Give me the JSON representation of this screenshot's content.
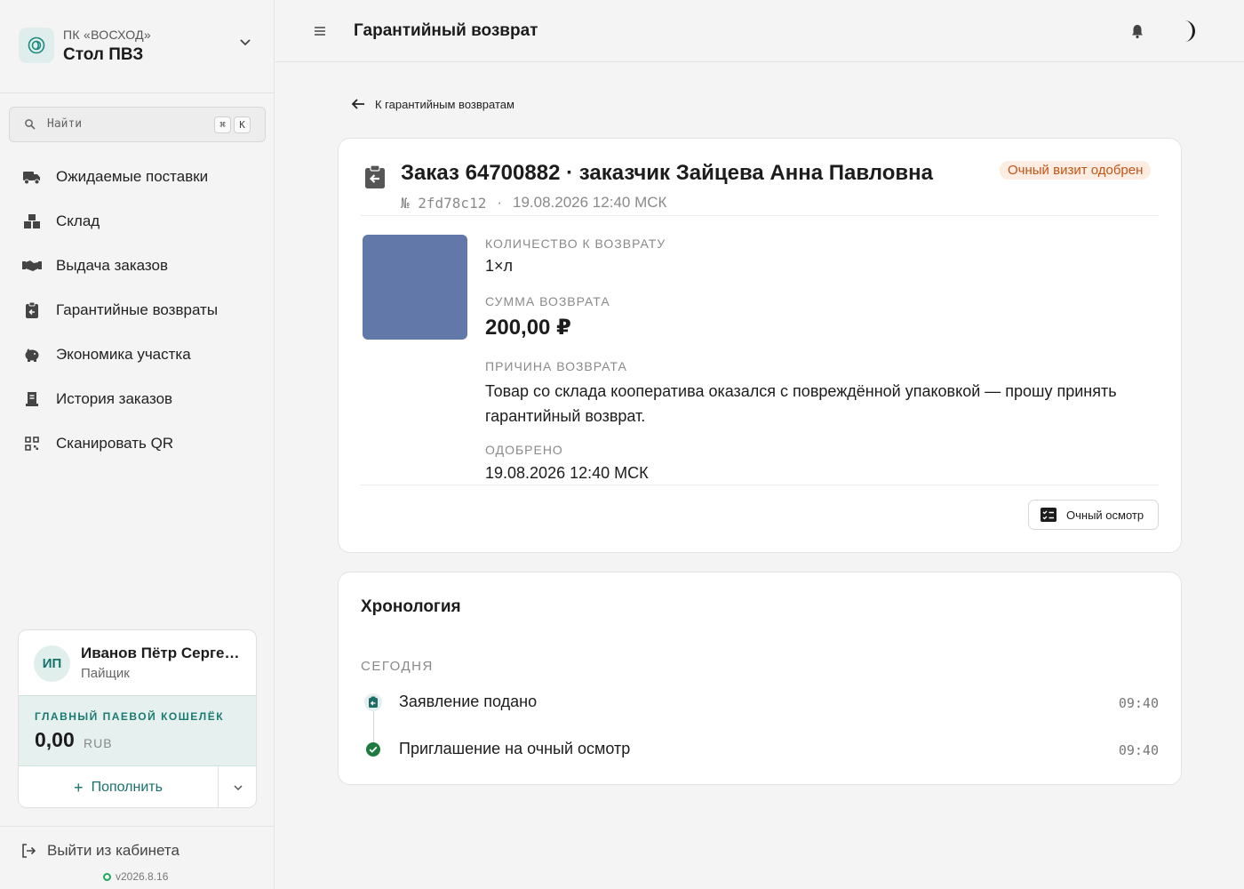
{
  "org": {
    "subtitle": "ПК «ВОСХОД»",
    "name": "Стол ПВЗ"
  },
  "search": {
    "placeholder": "Найти",
    "shortcut_mod": "⌘",
    "shortcut_key": "K"
  },
  "nav": {
    "items": [
      {
        "label": "Ожидаемые поставки",
        "icon": "truck-icon"
      },
      {
        "label": "Склад",
        "icon": "boxes-icon"
      },
      {
        "label": "Выдача заказов",
        "icon": "handshake-icon"
      },
      {
        "label": "Гарантийные возвраты",
        "icon": "clipboard-return-icon"
      },
      {
        "label": "Экономика участка",
        "icon": "piggy-bank-icon"
      },
      {
        "label": "История заказов",
        "icon": "receipt-icon"
      },
      {
        "label": "Сканировать QR",
        "icon": "qr-scan-icon"
      }
    ]
  },
  "user": {
    "initials": "ИП",
    "name": "Иванов Пётр Сергеевич",
    "role": "Пайщик",
    "wallet_label": "ГЛАВНЫЙ ПАЕВОЙ КОШЕЛЁК",
    "wallet_amount": "0,00",
    "wallet_currency": "RUB",
    "topup_label": "Пополнить"
  },
  "footer": {
    "logout_label": "Выйти из кабинета",
    "version": "v2026.8.16"
  },
  "header": {
    "title": "Гарантийный возврат"
  },
  "back_link": {
    "label": "К гарантийным возвратам"
  },
  "order": {
    "title": "Заказ 64700882 · заказчик Зайцева Анна Павловна",
    "status": "Очный визит одобрен",
    "number": "№ 2fd78c12",
    "meta_sep": "·",
    "datetime": "19.08.2026 12:40 МСК",
    "thumb_color": "#6178a8",
    "fields": {
      "qty_label": "КОЛИЧЕСТВО К ВОЗВРАТУ",
      "qty_value": "1×л",
      "sum_label": "СУММА ВОЗВРАТА",
      "sum_value": "200,00 ₽",
      "reason_label": "ПРИЧИНА ВОЗВРАТА",
      "reason_value": "Товар со склада кооператива оказался с повреждённой упаковкой — прошу принять гарантийный возврат.",
      "approved_label": "ОДОБРЕНО",
      "approved_value": "19.08.2026 12:40 МСК"
    },
    "inspect_button": "Очный осмотр"
  },
  "timeline": {
    "title": "Хронология",
    "day": "СЕГОДНЯ",
    "events": [
      {
        "text": "Заявление подано",
        "time": "09:40",
        "icon": "clipboard-return-icon"
      },
      {
        "text": "Приглашение на очный осмотр",
        "time": "09:40",
        "icon": "check-circle-icon"
      }
    ]
  },
  "colors": {
    "accent": "#16726a",
    "status_bg": "#fdece2",
    "status_fg": "#c05516",
    "success": "#1ea85b"
  }
}
